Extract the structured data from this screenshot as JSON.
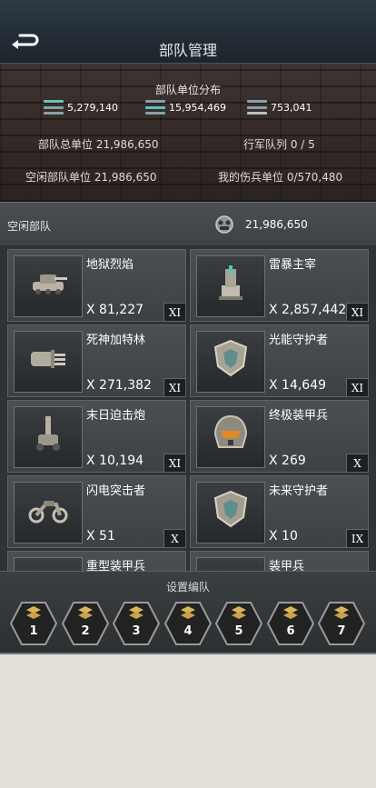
{
  "header": {
    "title": "部队管理"
  },
  "summary": {
    "title": "部队单位分布",
    "types": [
      {
        "value": "5,279,140",
        "icon": "infantry-icon",
        "color": "#5fc7b8"
      },
      {
        "value": "15,954,469",
        "icon": "vehicle-icon",
        "color": "#58c4c0"
      },
      {
        "value": "753,041",
        "icon": "tank-icon",
        "color": "#b7c0c4"
      }
    ],
    "total_units": "部队总单位 21,986,650",
    "march_queue": "行军队列 0 / 5",
    "idle_units": "空闲部队单位 21,986,650",
    "wounded_units": "我的伤兵单位 0/570,480"
  },
  "idle": {
    "label": "空闲部队",
    "count": "21,986,650"
  },
  "units": [
    {
      "name": "地狱烈焰",
      "count": "X 81,227",
      "rank": "XI",
      "icon": "tank-icon"
    },
    {
      "name": "雷暴主宰",
      "count": "X 2,857,442",
      "rank": "XI",
      "icon": "tower-icon"
    },
    {
      "name": "死神加特林",
      "count": "X 271,382",
      "rank": "XI",
      "icon": "gatling-icon"
    },
    {
      "name": "光能守护者",
      "count": "X 14,649",
      "rank": "XI",
      "icon": "shield-icon"
    },
    {
      "name": "末日迫击炮",
      "count": "X 10,194",
      "rank": "XI",
      "icon": "mortar-icon"
    },
    {
      "name": "终极装甲兵",
      "count": "X 269",
      "rank": "X",
      "icon": "armor-helmet-icon"
    },
    {
      "name": "闪电突击者",
      "count": "X 51",
      "rank": "X",
      "icon": "motorcycle-icon"
    },
    {
      "name": "未来守护者",
      "count": "X 10",
      "rank": "IX",
      "icon": "shield-icon"
    },
    {
      "name": "重型装甲兵",
      "count": "",
      "rank": "",
      "icon": ""
    },
    {
      "name": "装甲兵",
      "count": "",
      "rank": "",
      "icon": ""
    }
  ],
  "formation": {
    "title": "设置编队",
    "slots": [
      "1",
      "2",
      "3",
      "4",
      "5",
      "6",
      "7"
    ]
  }
}
